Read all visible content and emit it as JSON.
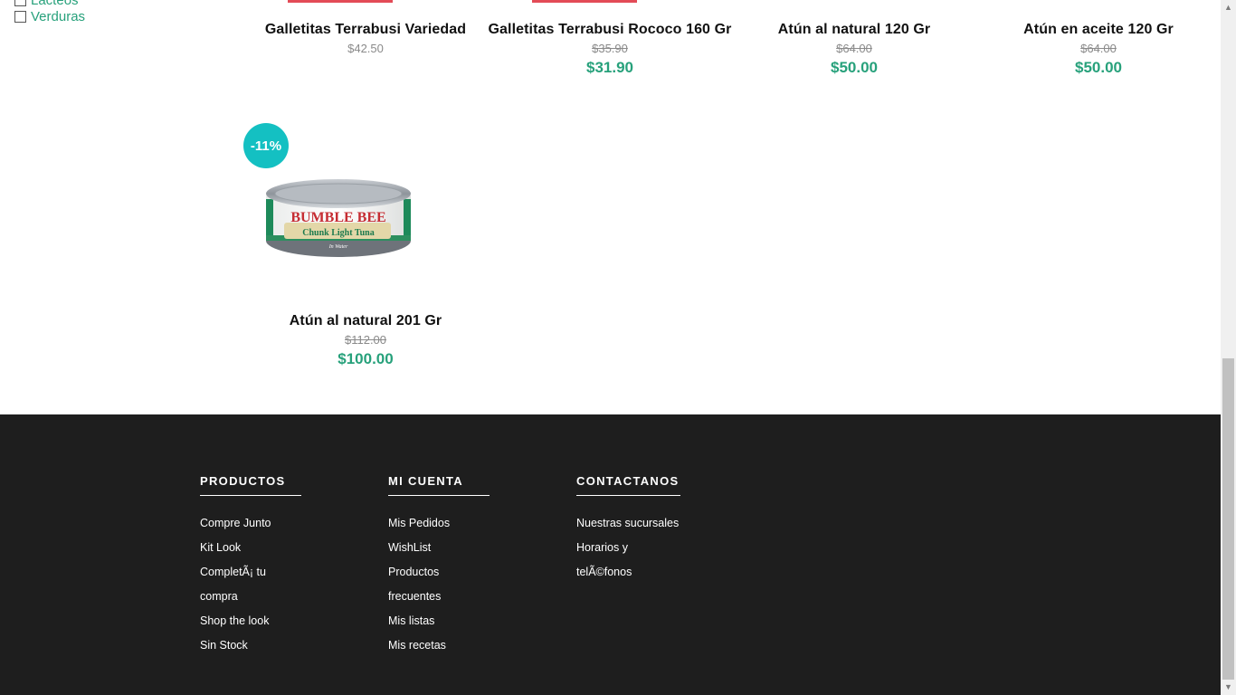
{
  "filters": [
    {
      "label": "Lacteos"
    },
    {
      "label": "Verduras"
    }
  ],
  "products_row1": [
    {
      "name": "Galletitas Terrabusi Variedad",
      "original_price": "$42.50",
      "price": ""
    },
    {
      "name": "Galletitas Terrabusi Rococo 160 Gr",
      "original_price": "$35.90",
      "price": "$31.90"
    },
    {
      "name": "Atún al natural 120 Gr",
      "original_price": "$64.00",
      "price": "$50.00"
    },
    {
      "name": "Atún en aceite 120 Gr",
      "original_price": "$64.00",
      "price": "$50.00"
    }
  ],
  "products_row2": [
    {
      "badge": "-11%",
      "image_brand": "BUMBLE BEE",
      "image_sub": "Chunk Light Tuna",
      "image_note": "In Water",
      "name": "Atún al natural 201 Gr",
      "original_price": "$112.00",
      "price": "$100.00"
    }
  ],
  "footer": {
    "columns": [
      {
        "heading": "PRODUCTOS",
        "links": [
          "Compre Junto",
          "Kit Look",
          "CompletÃ¡ tu compra",
          "Shop the look",
          "Sin Stock"
        ]
      },
      {
        "heading": "MI CUENTA",
        "links": [
          "Mis Pedidos",
          "WishList",
          "Productos frecuentes",
          "Mis listas",
          "Mis recetas"
        ]
      },
      {
        "heading": "CONTACTANOS",
        "links": [
          "Nuestras sucursales",
          "Horarios y telÃ©fonos"
        ]
      }
    ]
  },
  "colors": {
    "accent_green": "#27a17b",
    "badge_teal": "#14c0c2",
    "footer_bg": "#1e1e1e"
  }
}
